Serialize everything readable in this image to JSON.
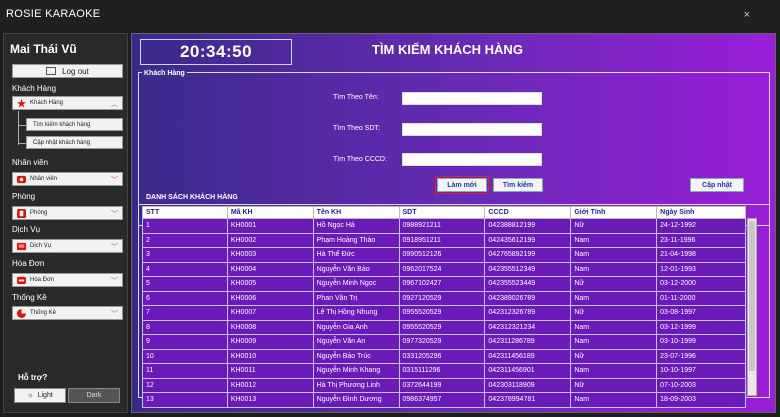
{
  "app": {
    "title": "ROSIE KARAOKE",
    "close": "×"
  },
  "sidebar": {
    "user": "Mai Thái Vũ",
    "logout": "Log out",
    "sections": {
      "customer": {
        "label": "Khách Hàng",
        "dropdown": "Khách Hàng",
        "sub": [
          "Tìm kiếm khách hàng",
          "Cập nhật khách hàng"
        ]
      },
      "staff": {
        "label": "Nhân viên",
        "dropdown": "Nhân viên"
      },
      "room": {
        "label": "Phòng",
        "dropdown": "Phòng"
      },
      "service": {
        "label": "Dịch Vụ",
        "dropdown": "Dịch Vụ"
      },
      "invoice": {
        "label": "Hóa Đơn",
        "dropdown": "Hóa Đơn"
      },
      "stats": {
        "label": "Thống Kê",
        "dropdown": "Thống Kê"
      }
    },
    "help": "Hỗ trợ?",
    "theme_light": "Light",
    "theme_dark": "Dark"
  },
  "main": {
    "clock": "20:34:50",
    "title": "TÌM KIẾM KHÁCH HÀNG",
    "form_legend": "Khách Hàng",
    "labels": {
      "name": "Tìm Theo Tên:",
      "phone": "Tìm Theo SDT:",
      "id": "Tìm Theo CCCD:"
    },
    "values": {
      "name": "",
      "phone": "",
      "id": ""
    },
    "buttons": {
      "refresh": "Làm mới",
      "search": "Tìm kiếm",
      "update": "Cập nhật"
    },
    "table_legend": "DANH SÁCH KHÁCH HÀNG",
    "columns": [
      "STT",
      "Mã KH",
      "Tên KH",
      "SDT",
      "CCCD",
      "Giới Tính",
      "Ngày Sinh"
    ],
    "rows": [
      [
        "1",
        "KH0001",
        "Hồ Ngọc Hà",
        "0988921211",
        "042388812199",
        "Nữ",
        "24-12-1992"
      ],
      [
        "2",
        "KH0002",
        "Phạm Hoàng Thảo",
        "0918951211",
        "042435612199",
        "Nam",
        "23-11-1996"
      ],
      [
        "3",
        "KH0003",
        "Hà Thế Đức",
        "0990512126",
        "042765892199",
        "Nam",
        "21-04-1998"
      ],
      [
        "4",
        "KH0004",
        "Nguyễn Văn Bảo",
        "0962017524",
        "042355512349",
        "Nam",
        "12-01-1993"
      ],
      [
        "5",
        "KH0005",
        "Nguyễn Minh Ngọc",
        "0967102427",
        "042355523449",
        "Nữ",
        "03-12-2000"
      ],
      [
        "6",
        "KH0006",
        "Phan Văn Trị",
        "0927120529",
        "042389026789",
        "Nam",
        "01-11-2000"
      ],
      [
        "7",
        "KH0007",
        "Lê Thị Hồng Nhung",
        "0955520529",
        "042312326789",
        "Nữ",
        "03-08-1997"
      ],
      [
        "8",
        "KH0008",
        "Nguyễn Gia Anh",
        "0955520529",
        "042312321234",
        "Nam",
        "03-12-1999"
      ],
      [
        "9",
        "KH0009",
        "Nguyễn Văn An",
        "0977320529",
        "042311286789",
        "Nam",
        "03-10-1999"
      ],
      [
        "10",
        "KH0010",
        "Nguyễn Bảo Trúc",
        "0331205296",
        "042311456189",
        "Nữ",
        "23-07-1996"
      ],
      [
        "11",
        "KH0011",
        "Nguyễn Minh Khang",
        "0315111296",
        "042311456901",
        "Nam",
        "10-10-1997"
      ],
      [
        "12",
        "KH0012",
        "Hà Thị Phương Linh",
        "0372644199",
        "042303118909",
        "Nữ",
        "07-10-2003"
      ],
      [
        "13",
        "KH0013",
        "Nguyễn Đình Dương",
        "0986374957",
        "042378994781",
        "Nam",
        "18-09-2003"
      ]
    ]
  }
}
